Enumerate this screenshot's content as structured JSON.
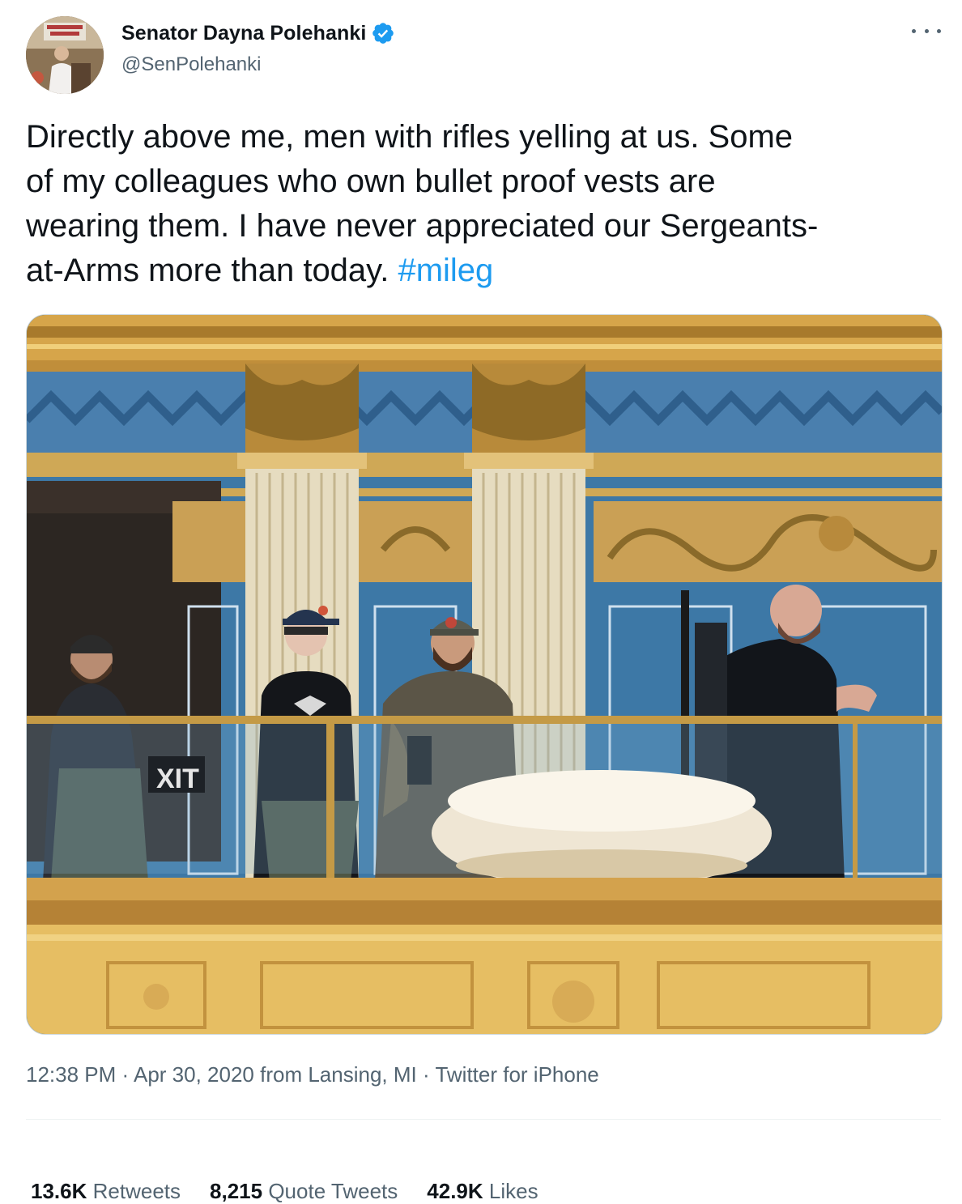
{
  "author": {
    "display_name": "Senator Dayna Polehanki",
    "handle": "@SenPolehanki",
    "verified": true
  },
  "tweet": {
    "text_lines": [
      "Directly above me, men with rifles yelling at us. Some",
      "of my colleagues who own bullet proof vests are",
      "wearing them. I have never appreciated our Sergeants-",
      "at-Arms more than today."
    ],
    "hashtag": "#mileg"
  },
  "meta": {
    "time": "12:38 PM",
    "date": "Apr 30, 2020",
    "location": "from Lansing, MI",
    "source": "Twitter for iPhone",
    "separator": "·"
  },
  "stats": {
    "retweets_count": "13.6K",
    "retweets_label": "Retweets",
    "quotes_count": "8,215",
    "quotes_label": "Quote Tweets",
    "likes_count": "42.9K",
    "likes_label": "Likes"
  },
  "photo": {
    "exit_sign": "XIT"
  },
  "icons": {
    "verified": "verified-badge-icon",
    "more": "more-options-icon"
  },
  "colors": {
    "link": "#1d9bf0",
    "secondary_text": "#536471",
    "primary_text": "#0f1419",
    "verified": "#1d9bf0"
  }
}
